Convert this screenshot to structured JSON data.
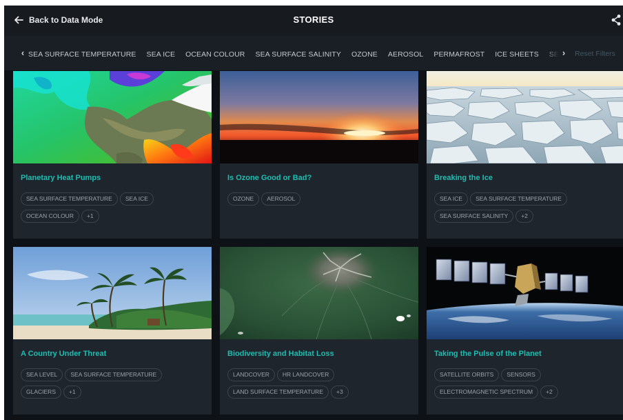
{
  "header": {
    "back_label": "Back to Data Mode",
    "title": "STORIES",
    "back_icon": "arrow-left-icon",
    "share_icon": "share-icon"
  },
  "filters": {
    "items": [
      "SEA SURFACE TEMPERATURE",
      "SEA ICE",
      "OCEAN COLOUR",
      "SEA SURFACE SALINITY",
      "OZONE",
      "AEROSOL",
      "PERMAFROST",
      "ICE SHEETS",
      "SEA LEVEL"
    ],
    "reset_label": "Reset Filters",
    "prev_icon": "chevron-left-icon",
    "next_icon": "chevron-right-icon"
  },
  "cards": [
    {
      "title": "Planetary Heat Pumps",
      "tags": [
        "SEA SURFACE TEMPERATURE",
        "SEA ICE",
        "OCEAN COLOUR",
        "+1"
      ]
    },
    {
      "title": "Is Ozone Good or Bad?",
      "tags": [
        "OZONE",
        "AEROSOL"
      ]
    },
    {
      "title": "Breaking the Ice",
      "tags": [
        "SEA ICE",
        "SEA SURFACE TEMPERATURE",
        "SEA SURFACE SALINITY",
        "+2"
      ]
    },
    {
      "title": "A Country Under Threat",
      "tags": [
        "SEA LEVEL",
        "SEA SURFACE TEMPERATURE",
        "GLACIERS",
        "+1"
      ]
    },
    {
      "title": "Biodiversity and Habitat Loss",
      "tags": [
        "LANDCOVER",
        "HR LANDCOVER",
        "LAND SURFACE TEMPERATURE",
        "+3"
      ]
    },
    {
      "title": "Taking the Pulse of the Planet",
      "tags": [
        "SATELLITE ORBITS",
        "SENSORS",
        "ELECTROMAGNETIC SPECTRUM",
        "+2"
      ]
    }
  ],
  "colors": {
    "background": "#0e1115",
    "topbar": "#171b20",
    "filterbar": "#1a1f25",
    "card": "#1f252c",
    "accent_title": "#1dbdb1",
    "tag_text": "#9aa2aa",
    "reset_text": "#3f5863"
  }
}
